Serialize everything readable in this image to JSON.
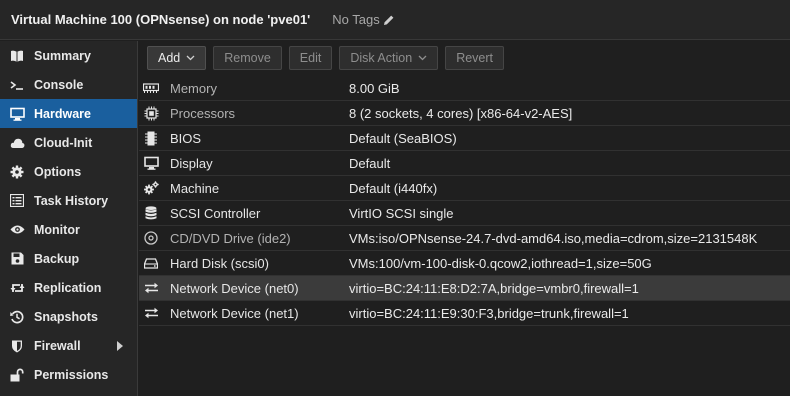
{
  "header": {
    "title": "Virtual Machine 100 (OPNsense) on node 'pve01'",
    "tags_label": "No Tags"
  },
  "sidebar": {
    "items": [
      {
        "label": "Summary",
        "icon": "book-icon"
      },
      {
        "label": "Console",
        "icon": "terminal-icon"
      },
      {
        "label": "Hardware",
        "icon": "monitor-icon",
        "active": true
      },
      {
        "label": "Cloud-Init",
        "icon": "cloud-icon"
      },
      {
        "label": "Options",
        "icon": "gear-icon"
      },
      {
        "label": "Task History",
        "icon": "list-icon"
      },
      {
        "label": "Monitor",
        "icon": "eye-icon"
      },
      {
        "label": "Backup",
        "icon": "floppy-icon"
      },
      {
        "label": "Replication",
        "icon": "retweet-icon"
      },
      {
        "label": "Snapshots",
        "icon": "history-icon"
      },
      {
        "label": "Firewall",
        "icon": "shield-icon"
      },
      {
        "label": "Permissions",
        "icon": "unlock-icon"
      }
    ]
  },
  "toolbar": {
    "add": "Add",
    "remove": "Remove",
    "edit": "Edit",
    "disk_action": "Disk Action",
    "revert": "Revert"
  },
  "hardware": [
    {
      "name": "Memory",
      "value": "8.00 GiB",
      "icon": "memory-icon",
      "dim": true
    },
    {
      "name": "Processors",
      "value": "8 (2 sockets, 4 cores) [x86-64-v2-AES]",
      "icon": "cpu-icon",
      "dim": true
    },
    {
      "name": "BIOS",
      "value": "Default (SeaBIOS)",
      "icon": "microchip-icon"
    },
    {
      "name": "Display",
      "value": "Default",
      "icon": "desktop-icon"
    },
    {
      "name": "Machine",
      "value": "Default (i440fx)",
      "icon": "cogs-icon"
    },
    {
      "name": "SCSI Controller",
      "value": "VirtIO SCSI single",
      "icon": "database-icon"
    },
    {
      "name": "CD/DVD Drive (ide2)",
      "value": "VMs:iso/OPNsense-24.7-dvd-amd64.iso,media=cdrom,size=2131548K",
      "icon": "cdrom-icon",
      "dim": true
    },
    {
      "name": "Hard Disk (scsi0)",
      "value": "VMs:100/vm-100-disk-0.qcow2,iothread=1,size=50G",
      "icon": "hdd-icon"
    },
    {
      "name": "Network Device (net0)",
      "value": "virtio=BC:24:11:E8:D2:7A,bridge=vmbr0,firewall=1",
      "icon": "exchange-icon",
      "selected": true
    },
    {
      "name": "Network Device (net1)",
      "value": "virtio=BC:24:11:E9:30:F3,bridge=trunk,firewall=1",
      "icon": "exchange-icon"
    }
  ],
  "colors": {
    "accent": "#1a5f9e",
    "background": "#1f1f1f",
    "panel": "#262626"
  }
}
